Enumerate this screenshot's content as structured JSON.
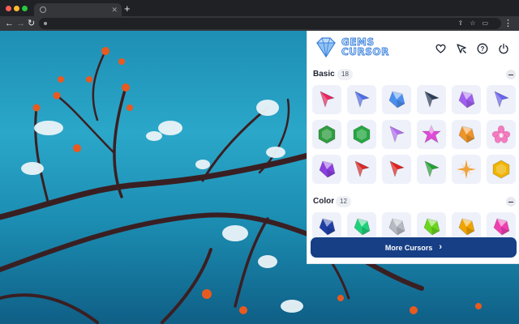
{
  "app": {
    "name_line1": "GEMS",
    "name_line2": "CURSOR"
  },
  "header_icons": [
    "heart-icon",
    "cursor-arrow-icon",
    "help-icon",
    "power-icon"
  ],
  "sections": [
    {
      "title": "Basic",
      "count": "18",
      "items": [
        {
          "shape": "arrow",
          "color": "#e8275f"
        },
        {
          "shape": "arrow",
          "color": "#4f6ee8"
        },
        {
          "shape": "crystal",
          "color": "#4a8ff0"
        },
        {
          "shape": "arrow",
          "color": "#2c3e5a"
        },
        {
          "shape": "crystal",
          "color": "#a05ff0"
        },
        {
          "shape": "arrow",
          "color": "#6b63ef"
        },
        {
          "shape": "hexagon",
          "color": "#2f9d3f"
        },
        {
          "shape": "hexagon",
          "color": "#27a744"
        },
        {
          "shape": "arrow",
          "color": "#b26df0"
        },
        {
          "shape": "star",
          "color": "#e04ad8"
        },
        {
          "shape": "crystal",
          "color": "#ef9428"
        },
        {
          "shape": "flower",
          "color": "#f57ac0"
        },
        {
          "shape": "crystal",
          "color": "#8b3fe0"
        },
        {
          "shape": "arrow",
          "color": "#d92a2a"
        },
        {
          "shape": "arrow",
          "color": "#e32020"
        },
        {
          "shape": "arrow",
          "color": "#24a135"
        },
        {
          "shape": "spark",
          "color": "#f0a23a"
        },
        {
          "shape": "hexagon",
          "color": "#f0b400"
        }
      ]
    },
    {
      "title": "Color",
      "count": "12",
      "items": [
        {
          "shape": "crystal",
          "color": "#1f3fa6"
        },
        {
          "shape": "crystal",
          "color": "#1fd17a"
        },
        {
          "shape": "crystal",
          "color": "#b5b9c2"
        },
        {
          "shape": "crystal",
          "color": "#6ad61e"
        },
        {
          "shape": "crystal",
          "color": "#f0a400"
        },
        {
          "shape": "crystal",
          "color": "#ef3fb0"
        }
      ]
    }
  ],
  "more_button": {
    "label": "More Cursors"
  },
  "colors": {
    "button": "#163f86",
    "accent": "#3b7fd9"
  }
}
